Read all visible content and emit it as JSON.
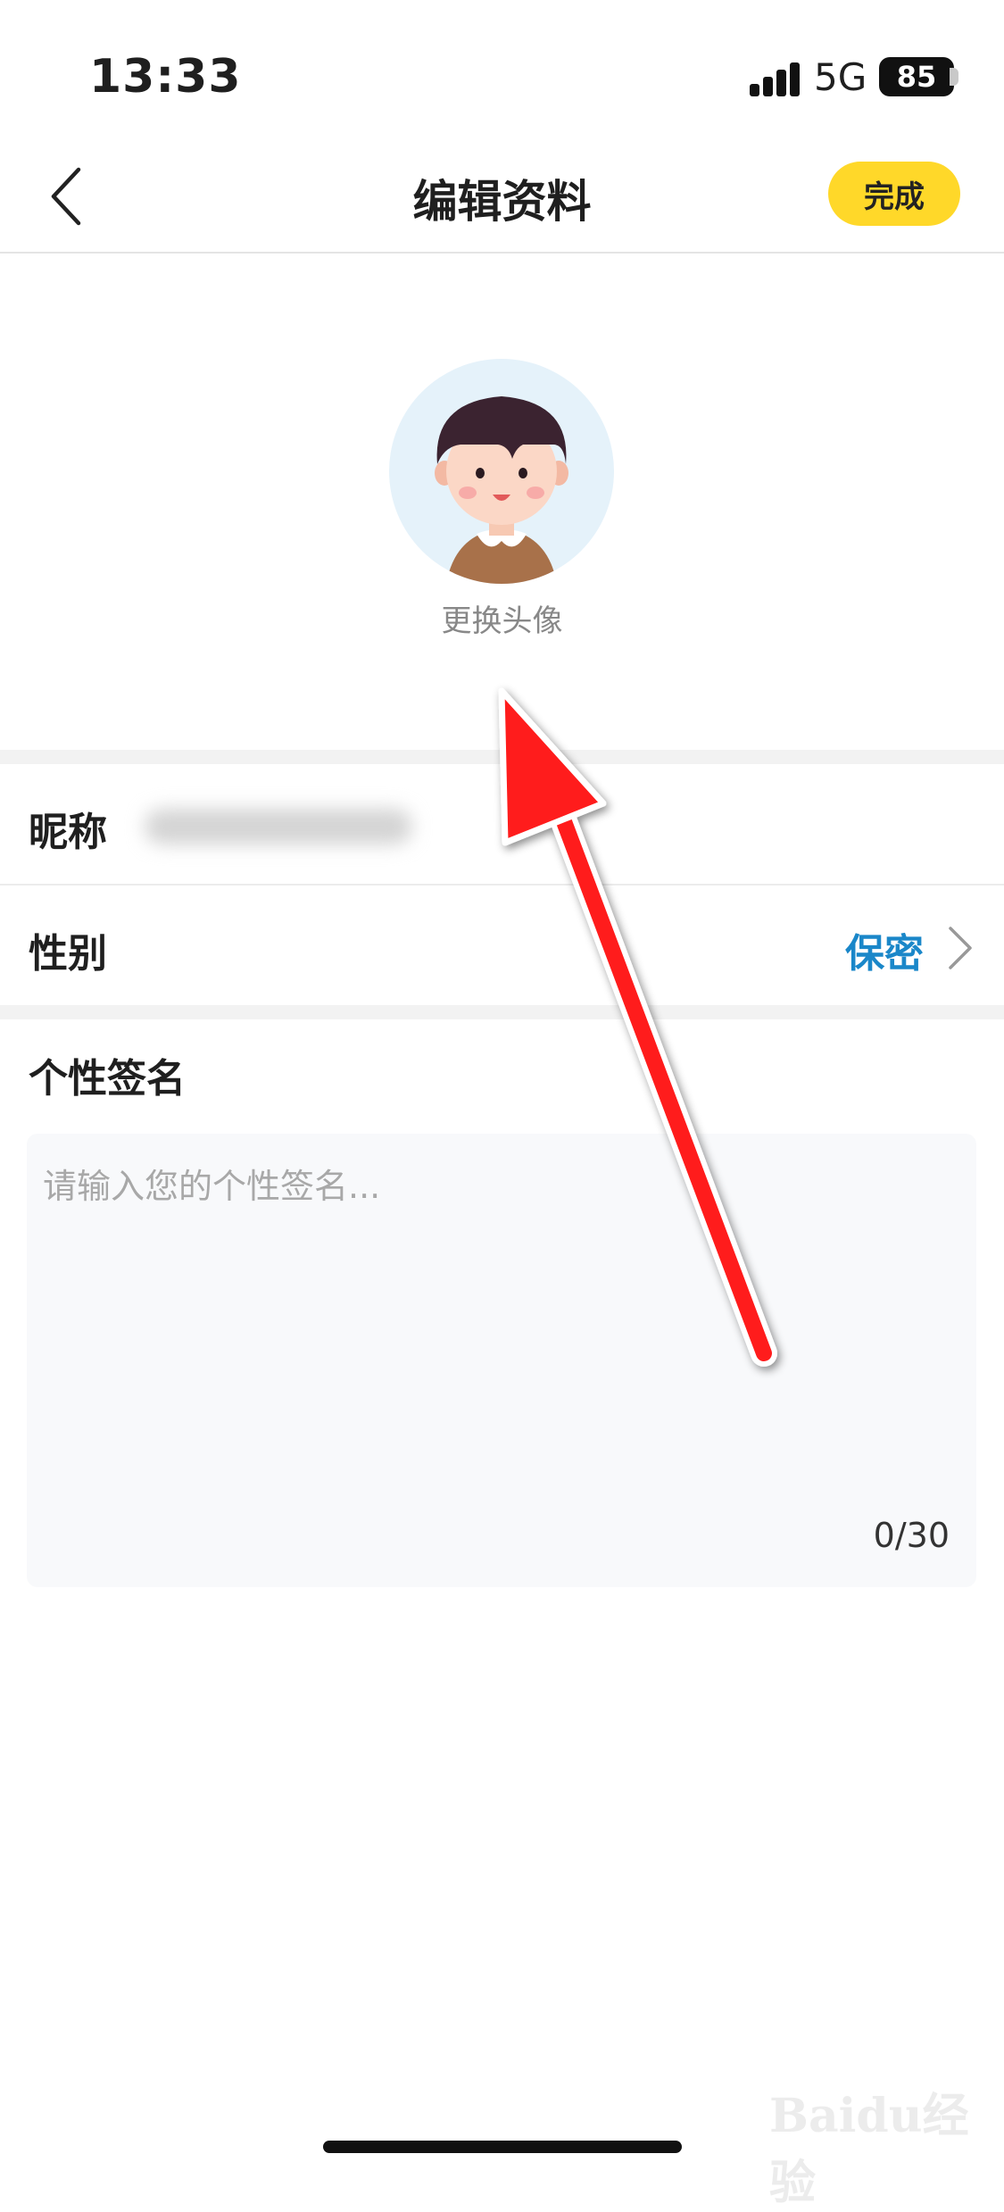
{
  "status_bar": {
    "time": "13:33",
    "network": "5G",
    "battery": "85"
  },
  "nav": {
    "title": "编辑资料",
    "done_label": "完成",
    "back_icon": "chevron-left-icon"
  },
  "avatar_section": {
    "change_avatar_label": "更换头像"
  },
  "nickname": {
    "label": "昵称"
  },
  "gender": {
    "label": "性别",
    "value": "保密",
    "chevron_icon": "chevron-right-icon"
  },
  "signature": {
    "title": "个性签名",
    "placeholder": "请输入您的个性签名...",
    "counter": "0/30"
  },
  "colors": {
    "accent_yellow": "#ffd829",
    "link_blue": "#1a87c9",
    "annotation_red": "#ff1a1a"
  },
  "watermark": {
    "text": "Baidu经验"
  }
}
